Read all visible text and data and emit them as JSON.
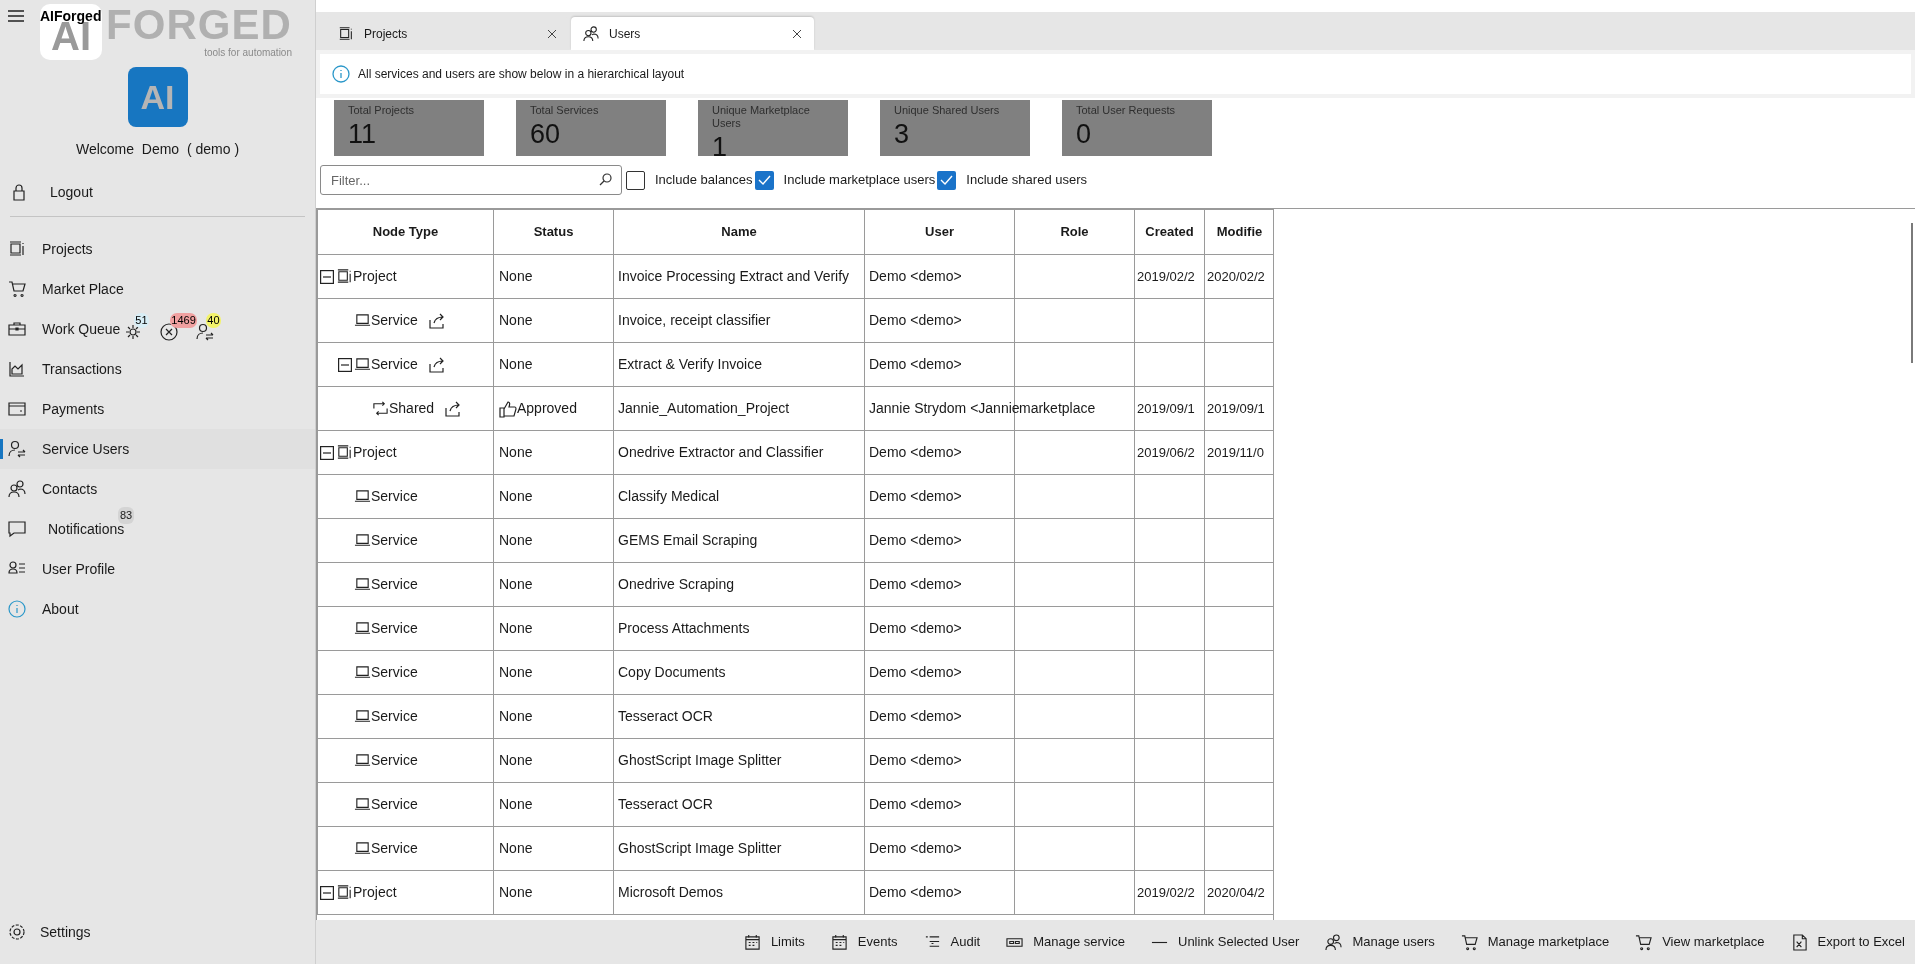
{
  "app": {
    "title": "AIForged",
    "logo_mark": "AI",
    "logo_text": "FORGED",
    "logo_tagline": "tools for automation",
    "avatar_text": "AI",
    "welcome": "Welcome  Demo  ( demo )",
    "logout": "Logout",
    "settings": "Settings"
  },
  "sidebar": {
    "items": [
      {
        "label": "Projects",
        "kind": "projects",
        "selected": false
      },
      {
        "label": "Market Place",
        "kind": "cart",
        "selected": false
      },
      {
        "label": "Work Queue",
        "kind": "briefcase",
        "selected": false,
        "badges": [
          {
            "text": "51",
            "kind": "gear",
            "color": "#d8eef6"
          },
          {
            "text": "1469",
            "kind": "error",
            "color": "#f0a0a0"
          },
          {
            "text": "40",
            "kind": "user-switch",
            "color": "#f3f36a"
          }
        ]
      },
      {
        "label": "Transactions",
        "kind": "chart",
        "selected": false
      },
      {
        "label": "Payments",
        "kind": "card",
        "selected": false
      },
      {
        "label": "Service Users",
        "kind": "user-switch",
        "selected": true
      },
      {
        "label": "Contacts",
        "kind": "people",
        "selected": false
      },
      {
        "label": "Notifications",
        "kind": "chat",
        "selected": false,
        "count": "83"
      },
      {
        "label": "User Profile",
        "kind": "profile",
        "selected": false
      },
      {
        "label": "About",
        "kind": "info",
        "selected": false
      }
    ]
  },
  "tabs": [
    {
      "label": "Projects",
      "kind": "projects",
      "selected": false
    },
    {
      "label": "Users",
      "kind": "people",
      "selected": true
    }
  ],
  "info": "All services and users are show below in a hierarchical layout",
  "stats": [
    {
      "label": "Total Projects",
      "value": "11"
    },
    {
      "label": "Total Services",
      "value": "60"
    },
    {
      "label": "Unique Marketplace Users",
      "value": "1"
    },
    {
      "label": "Unique Shared Users",
      "value": "3"
    },
    {
      "label": "Total User Requests",
      "value": "0"
    }
  ],
  "filter": {
    "placeholder": "Filter..."
  },
  "options": [
    {
      "label": "Include balances",
      "checked": false
    },
    {
      "label": "Include marketplace users",
      "checked": true
    },
    {
      "label": "Include shared users",
      "checked": true
    }
  ],
  "table": {
    "columns": [
      "Node Type",
      "Status",
      "Name",
      "User",
      "Role",
      "Created",
      "Modifie"
    ],
    "rows": [
      {
        "kind": "project",
        "node_type": "Project",
        "expanded": true,
        "share": false,
        "approved": false,
        "status": "None",
        "name": "Invoice Processing Extract and Verify",
        "user": "Demo <demo>",
        "created": "2019/02/2",
        "modified": "2020/02/2",
        "children": [
          {
            "kind": "service",
            "node_type": "Service",
            "share": true,
            "approved": false,
            "status": "None",
            "name": "Invoice, receipt classifier",
            "user": "Demo <demo>"
          },
          {
            "kind": "service",
            "node_type": "Service",
            "expanded": true,
            "share": true,
            "approved": false,
            "status": "None",
            "name": "Extract & Verify Invoice",
            "user": "Demo <demo>",
            "children": [
              {
                "kind": "shared",
                "node_type": "Shared",
                "share": true,
                "approved": true,
                "status": "Approved",
                "name": "Jannie_Automation_Project",
                "user": "Jannie Strydom <Jannie",
                "role": "marketplace",
                "created": "2019/09/1",
                "modified": "2019/09/1"
              }
            ]
          }
        ]
      },
      {
        "kind": "project",
        "node_type": "Project",
        "expanded": true,
        "share": false,
        "approved": false,
        "status": "None",
        "name": "Onedrive Extractor and Classifier",
        "user": "Demo <demo>",
        "created": "2019/06/2",
        "modified": "2019/11/0",
        "children": [
          {
            "kind": "service",
            "node_type": "Service",
            "share": false,
            "approved": false,
            "status": "None",
            "name": "Classify Medical",
            "user": "Demo <demo>"
          },
          {
            "kind": "service",
            "node_type": "Service",
            "share": false,
            "approved": false,
            "status": "None",
            "name": "GEMS Email Scraping",
            "user": "Demo <demo>"
          },
          {
            "kind": "service",
            "node_type": "Service",
            "share": false,
            "approved": false,
            "status": "None",
            "name": "Onedrive Scraping",
            "user": "Demo <demo>"
          },
          {
            "kind": "service",
            "node_type": "Service",
            "share": false,
            "approved": false,
            "status": "None",
            "name": "Process Attachments",
            "user": "Demo <demo>"
          },
          {
            "kind": "service",
            "node_type": "Service",
            "share": false,
            "approved": false,
            "status": "None",
            "name": "Copy Documents",
            "user": "Demo <demo>"
          },
          {
            "kind": "service",
            "node_type": "Service",
            "share": false,
            "approved": false,
            "status": "None",
            "name": "Tesseract OCR",
            "user": "Demo <demo>"
          },
          {
            "kind": "service",
            "node_type": "Service",
            "share": false,
            "approved": false,
            "status": "None",
            "name": "GhostScript Image Splitter",
            "user": "Demo <demo>"
          },
          {
            "kind": "service",
            "node_type": "Service",
            "share": false,
            "approved": false,
            "status": "None",
            "name": "Tesseract OCR",
            "user": "Demo <demo>"
          },
          {
            "kind": "service",
            "node_type": "Service",
            "share": false,
            "approved": false,
            "status": "None",
            "name": "GhostScript Image Splitter",
            "user": "Demo <demo>"
          }
        ]
      },
      {
        "kind": "project",
        "node_type": "Project",
        "expanded": true,
        "share": false,
        "approved": false,
        "status": "None",
        "name": "Microsoft Demos",
        "user": "Demo <demo>",
        "created": "2019/02/2",
        "modified": "2020/04/2"
      }
    ]
  },
  "toolbar": [
    {
      "label": "Limits",
      "kind": "calendar"
    },
    {
      "label": "Events",
      "kind": "calendar"
    },
    {
      "label": "Audit",
      "kind": "list"
    },
    {
      "label": "Manage service",
      "kind": "slot"
    },
    {
      "label": "Unlink Selected User",
      "kind": "dash"
    },
    {
      "label": "Manage users",
      "kind": "people"
    },
    {
      "label": "Manage marketplace",
      "kind": "cart"
    },
    {
      "label": "View marketplace",
      "kind": "cart"
    },
    {
      "label": "Export to Excel",
      "kind": "excel"
    }
  ]
}
